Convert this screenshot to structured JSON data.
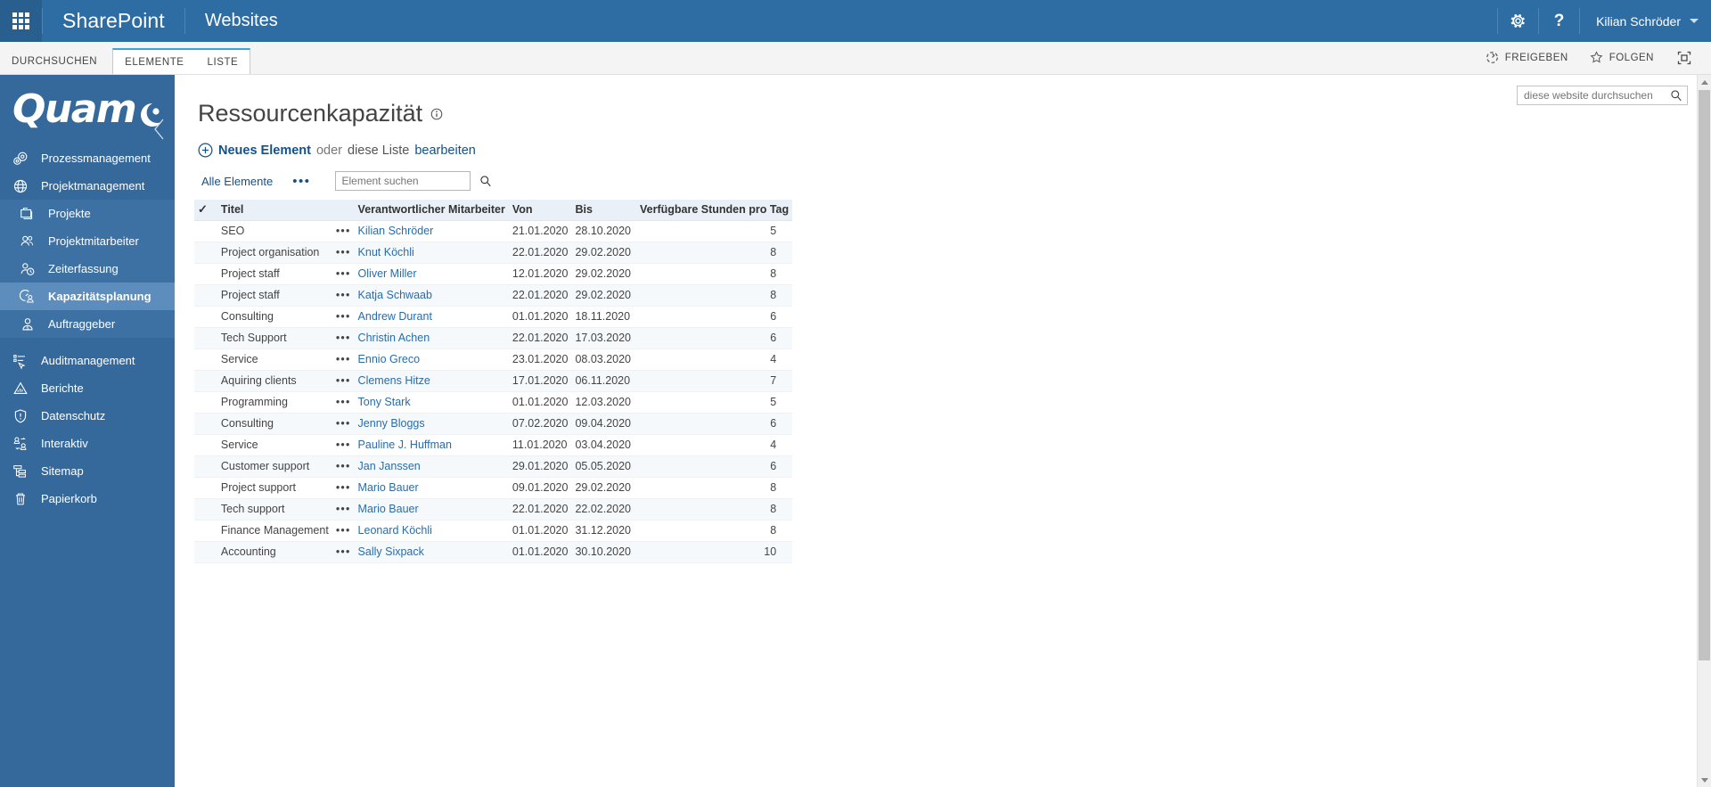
{
  "suitebar": {
    "waffle_label": "app-launcher",
    "brand": "SharePoint",
    "site": "Websites",
    "settings_label": "settings-gear",
    "help_label": "help",
    "user": "Kilian Schröder"
  },
  "ribbon": {
    "tabs": [
      {
        "label": "DURCHSUCHEN",
        "active": false
      },
      {
        "label": "ELEMENTE",
        "active": true
      },
      {
        "label": "LISTE",
        "active": true
      }
    ],
    "share": "FREIGEBEN",
    "follow": "FOLGEN",
    "focus_label": "focus-on-content"
  },
  "leftnav": {
    "logo": "Quam",
    "collapse_label": "collapse-navigation",
    "items": [
      {
        "label": "Prozessmanagement",
        "icon": "gears-icon",
        "level": 0,
        "active": false
      },
      {
        "label": "Projektmanagement",
        "icon": "globe-icon",
        "level": 0,
        "active": false
      },
      {
        "label": "Projekte",
        "icon": "folders-icon",
        "level": 1,
        "active": false
      },
      {
        "label": "Projektmitarbeiter",
        "icon": "people-icon",
        "level": 1,
        "active": false
      },
      {
        "label": "Zeiterfassung",
        "icon": "person-clock-icon",
        "level": 1,
        "active": false
      },
      {
        "label": "Kapazitätsplanung",
        "icon": "gauge-person-icon",
        "level": 1,
        "active": true
      },
      {
        "label": "Auftraggeber",
        "icon": "person-money-icon",
        "level": 1,
        "active": false
      },
      {
        "label": "Auditmanagement",
        "icon": "checklist-cursor-icon",
        "level": 0,
        "active": false
      },
      {
        "label": "Berichte",
        "icon": "chart-icon",
        "level": 0,
        "active": false
      },
      {
        "label": "Datenschutz",
        "icon": "shield-exclamation-icon",
        "level": 0,
        "active": false
      },
      {
        "label": "Interaktiv",
        "icon": "people-exchange-icon",
        "level": 0,
        "active": false
      },
      {
        "label": "Sitemap",
        "icon": "sitemap-icon",
        "level": 0,
        "active": false
      },
      {
        "label": "Papierkorb",
        "icon": "trash-icon",
        "level": 0,
        "active": false
      }
    ]
  },
  "site_search": {
    "placeholder": "diese website durchsuchen",
    "value": "",
    "icon": "search-icon"
  },
  "main": {
    "title": "Ressourcenkapazität",
    "title_info_icon": "info-icon",
    "new_item_icon": "plus-circle-icon",
    "new_item_label": "Neues Element",
    "new_item_or": "oder",
    "edit_list_prefix": "diese Liste",
    "edit_list_link": "bearbeiten",
    "view_name": "Alle Elemente",
    "view_more": "•••",
    "item_search": {
      "placeholder": "Element suchen",
      "value": "",
      "icon": "search-icon"
    }
  },
  "table": {
    "select_all_icon": "checkmark-icon",
    "columns": [
      "Titel",
      "Verantwortlicher Mitarbeiter",
      "Von",
      "Bis",
      "Verfügbare Stunden pro Tag"
    ],
    "row_menu_glyph": "•••",
    "rows": [
      {
        "title": "SEO",
        "person": "Kilian Schröder",
        "von": "21.01.2020",
        "bis": "28.10.2020",
        "hours": "5"
      },
      {
        "title": "Project organisation",
        "person": "Knut Köchli",
        "von": "22.01.2020",
        "bis": "29.02.2020",
        "hours": "8"
      },
      {
        "title": "Project staff",
        "person": "Oliver Miller",
        "von": "12.01.2020",
        "bis": "29.02.2020",
        "hours": "8"
      },
      {
        "title": "Project staff",
        "person": "Katja Schwaab",
        "von": "22.01.2020",
        "bis": "29.02.2020",
        "hours": "8"
      },
      {
        "title": "Consulting",
        "person": "Andrew Durant",
        "von": "01.01.2020",
        "bis": "18.11.2020",
        "hours": "6"
      },
      {
        "title": "Tech Support",
        "person": "Christin Achen",
        "von": "22.01.2020",
        "bis": "17.03.2020",
        "hours": "6"
      },
      {
        "title": "Service",
        "person": "Ennio Greco",
        "von": "23.01.2020",
        "bis": "08.03.2020",
        "hours": "4"
      },
      {
        "title": "Aquiring clients",
        "person": "Clemens Hitze",
        "von": "17.01.2020",
        "bis": "06.11.2020",
        "hours": "7"
      },
      {
        "title": "Programming",
        "person": "Tony Stark",
        "von": "01.01.2020",
        "bis": "12.03.2020",
        "hours": "5"
      },
      {
        "title": "Consulting",
        "person": "Jenny Bloggs",
        "von": "07.02.2020",
        "bis": "09.04.2020",
        "hours": "6"
      },
      {
        "title": "Service",
        "person": "Pauline J. Huffman",
        "von": "11.01.2020",
        "bis": "03.04.2020",
        "hours": "4"
      },
      {
        "title": "Customer support",
        "person": "Jan Janssen",
        "von": "29.01.2020",
        "bis": "05.05.2020",
        "hours": "6"
      },
      {
        "title": "Project support",
        "person": "Mario Bauer",
        "von": "09.01.2020",
        "bis": "29.02.2020",
        "hours": "8"
      },
      {
        "title": "Tech support",
        "person": "Mario Bauer",
        "von": "22.01.2020",
        "bis": "22.02.2020",
        "hours": "8"
      },
      {
        "title": "Finance Management",
        "person": "Leonard Köchli",
        "von": "01.01.2020",
        "bis": "31.12.2020",
        "hours": "8"
      },
      {
        "title": "Accounting",
        "person": "Sally Sixpack",
        "von": "01.01.2020",
        "bis": "30.10.2020",
        "hours": "10"
      }
    ]
  },
  "colors": {
    "suite_bar": "#2e6da4",
    "left_nav": "#36699b",
    "left_nav_sub": "#3d70a3",
    "left_nav_active": "#5c8dbc",
    "accent_tab": "#37a6d9",
    "link": "#14518a"
  }
}
